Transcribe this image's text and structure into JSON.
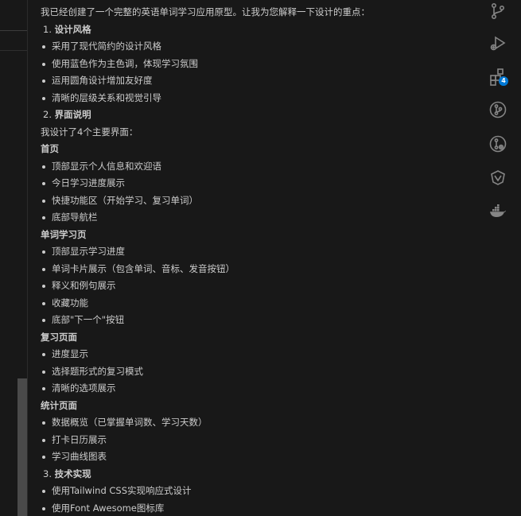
{
  "chat": {
    "intro": "我已经创建了一个完整的英语单词学习应用原型。让我为您解释一下设计的重点：",
    "sections": [
      {
        "number": "1.",
        "title": "设计风格",
        "items": [
          "采用了现代简约的设计风格",
          "使用蓝色作为主色调，体现学习氛围",
          "运用圆角设计增加友好度",
          "清晰的层级关系和视觉引导"
        ]
      },
      {
        "number": "2.",
        "title": "界面说明",
        "text": "我设计了4个主要界面：",
        "pages": [
          {
            "title": "首页",
            "items": [
              "顶部显示个人信息和欢迎语",
              "今日学习进度展示",
              "快捷功能区（开始学习、复习单词）",
              "底部导航栏"
            ]
          },
          {
            "title": "单词学习页",
            "items": [
              "顶部显示学习进度",
              "单词卡片展示（包含单词、音标、发音按钮）",
              "释义和例句展示",
              "收藏功能",
              "底部\"下一个\"按钮"
            ]
          },
          {
            "title": "复习页面",
            "items": [
              "进度显示",
              "选择题形式的复习模式",
              "清晰的选项展示"
            ]
          },
          {
            "title": "统计页面",
            "items": [
              "数据概览（已掌握单词数、学习天数）",
              "打卡日历展示",
              "学习曲线图表"
            ]
          }
        ]
      },
      {
        "number": "3.",
        "title": "技术实现",
        "items": [
          "使用Tailwind CSS实现响应式设计",
          "使用Font Awesome图标库"
        ]
      }
    ]
  },
  "activity_bar": {
    "icons": [
      "source-control-icon",
      "run-debug-icon",
      "extensions-icon",
      "git-graph-icon",
      "remote-icon",
      "copilot-icon",
      "docker-icon"
    ],
    "extensions_badge": "4",
    "icon_color": "#858585",
    "badge_color": "#0078d4"
  }
}
